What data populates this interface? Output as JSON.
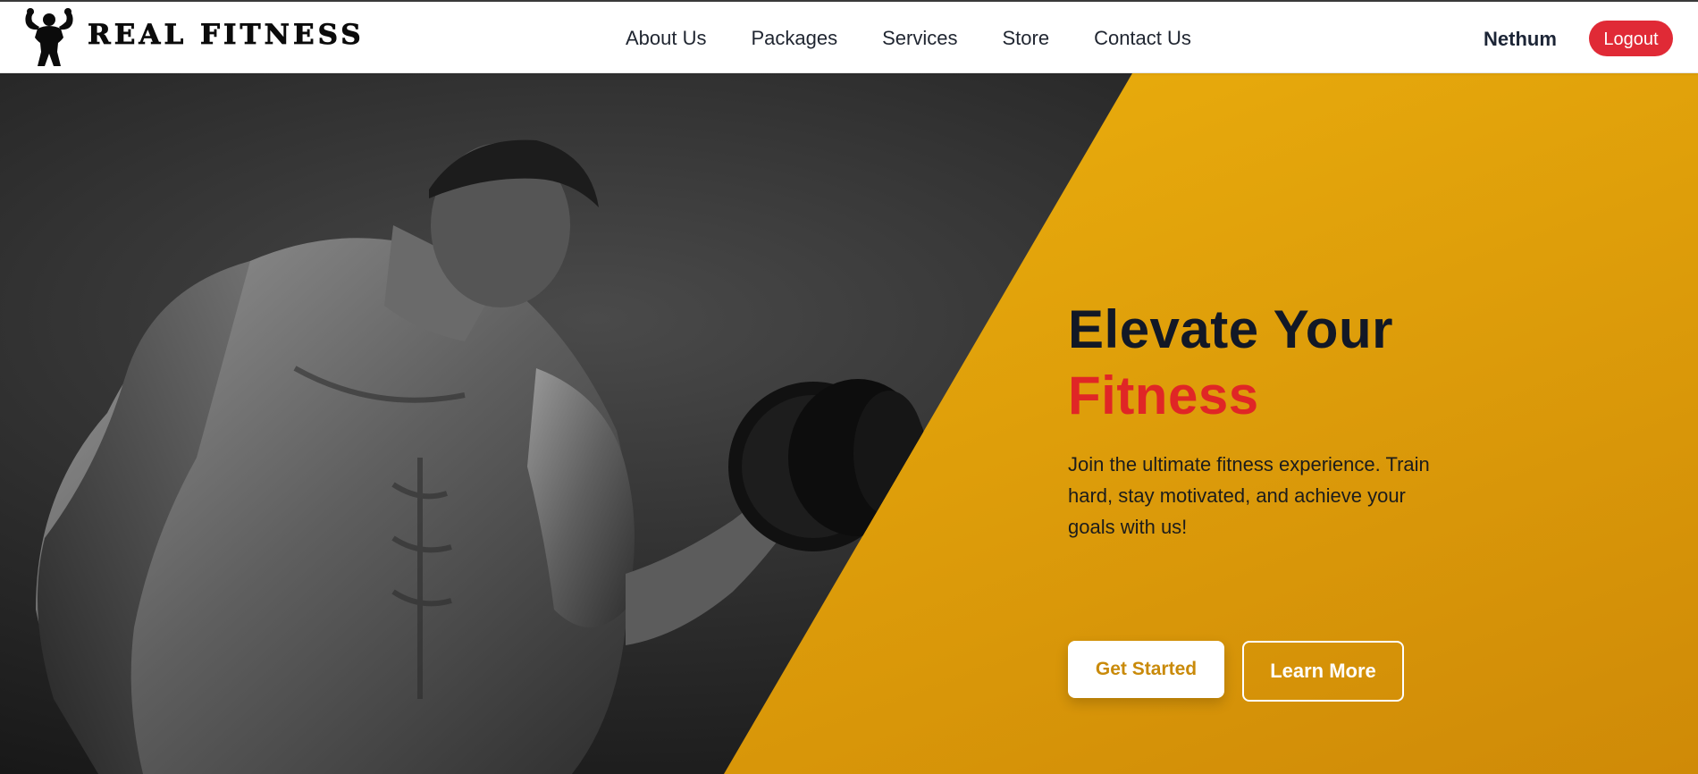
{
  "brand": {
    "name": "REAL FITNESS",
    "logo_icon": "bodybuilder-flexing-icon"
  },
  "nav": {
    "items": [
      {
        "label": "About Us"
      },
      {
        "label": "Packages"
      },
      {
        "label": "Services"
      },
      {
        "label": "Store"
      },
      {
        "label": "Contact Us"
      }
    ]
  },
  "user": {
    "name": "Nethum",
    "logout_label": "Logout"
  },
  "hero": {
    "headline_line1": "Elevate Your",
    "headline_line2": "Fitness",
    "subtext": "Join the ultimate fitness experience. Train hard, stay motivated, and achieve your goals with us!",
    "primary_button": "Get Started",
    "secondary_button": "Learn More",
    "image": "black-and-white-photo-man-lifting-dumbbell"
  },
  "colors": {
    "accent_red": "#e02626",
    "logout_red": "#e02a36",
    "hero_yellow": "#f2b80f",
    "hero_orange": "#cf8a07",
    "headline_dark": "#121826"
  }
}
